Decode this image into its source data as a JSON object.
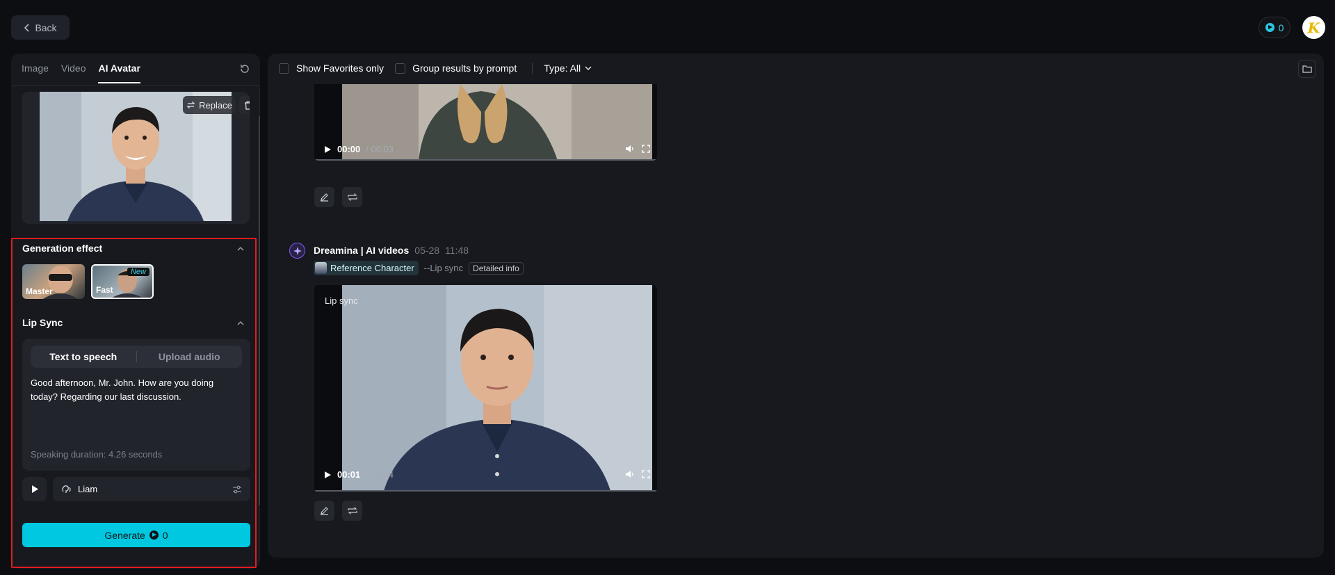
{
  "header": {
    "back_label": "Back",
    "credits": "0",
    "user_initial": "K"
  },
  "left_panel": {
    "tabs": [
      {
        "label": "Image",
        "active": false
      },
      {
        "label": "Video",
        "active": false
      },
      {
        "label": "AI Avatar",
        "active": true
      }
    ],
    "replace_label": "Replace",
    "generation_effect": {
      "title": "Generation effect",
      "options": [
        {
          "label": "Master",
          "badge": "",
          "selected": false
        },
        {
          "label": "Fast",
          "badge": "New",
          "selected": true
        }
      ]
    },
    "lip_sync": {
      "title": "Lip Sync",
      "modes": [
        {
          "label": "Text to speech",
          "active": true
        },
        {
          "label": "Upload audio",
          "active": false
        }
      ],
      "text": "Good afternoon, Mr. John. How are you doing today? Regarding our last discussion.",
      "duration": "Speaking duration: 4.26 seconds",
      "voice_name": "Liam"
    },
    "generate": {
      "label": "Generate",
      "cost": "0"
    }
  },
  "main": {
    "filters": {
      "favorites_label": "Show Favorites only",
      "favorites_checked": false,
      "group_label": "Group results by prompt",
      "group_checked": false,
      "type_label": "Type: All"
    },
    "results": [
      {
        "current_time": "00:00",
        "duration": "/ 00:03"
      },
      {
        "author": "Dreamina | AI videos",
        "date": "05-28",
        "time": "11:48",
        "reference_tag": "Reference Character",
        "mode_tag": "--Lip sync",
        "detail_label": "Detailed info",
        "overlay_label": "Lip sync",
        "current_time": "00:01",
        "duration": "/ 00:04"
      }
    ]
  },
  "colors": {
    "accent": "#00c8e1",
    "highlight_border": "#e21c22",
    "brand": "#7b5cff"
  }
}
